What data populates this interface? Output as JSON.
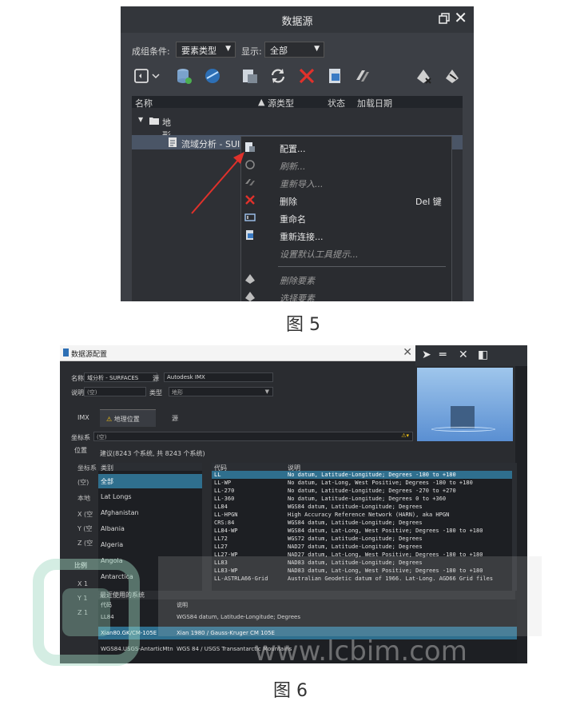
{
  "figure5": {
    "caption": "图 5",
    "title": "数据源",
    "group_label": "成组条件:",
    "group_value": "要素类型",
    "show_label": "显示:",
    "show_value": "全部",
    "columns": [
      "名称",
      "源类型",
      "状态",
      "加载日期"
    ],
    "tree_folder": "地形",
    "tree_item": "流域分析 - SUI",
    "context_menu": [
      {
        "label": "配置...",
        "key": "",
        "disabled": false,
        "icon": "config-icon"
      },
      {
        "label": "刷新...",
        "key": "",
        "disabled": true,
        "icon": "refresh-icon"
      },
      {
        "label": "重新导入...",
        "key": "",
        "disabled": true,
        "icon": "reimport-icon"
      },
      {
        "label": "删除",
        "key": "Del 键",
        "disabled": false,
        "icon": "delete-icon"
      },
      {
        "label": "重命名",
        "key": "",
        "disabled": false,
        "icon": "rename-icon"
      },
      {
        "label": "重新连接...",
        "key": "",
        "disabled": false,
        "icon": "reconnect-icon"
      },
      {
        "label": "设置默认工具提示...",
        "key": "",
        "disabled": true,
        "icon": ""
      },
      {
        "label": "删除要素",
        "key": "",
        "disabled": true,
        "icon": "delete-feature-icon"
      },
      {
        "label": "选择要素",
        "key": "",
        "disabled": true,
        "icon": "select-feature-icon"
      }
    ]
  },
  "figure6": {
    "caption": "图 6",
    "dialog_title": "数据源配置",
    "name_label": "名称",
    "name_value": "域分析 - SURFACES",
    "source_label": "源",
    "source_value": "Autodesk IMX",
    "desc_label": "说明",
    "desc_value": "(空)",
    "type_label": "类型",
    "type_value": "地形",
    "tabs": [
      "IMX",
      "地理位置",
      "源"
    ],
    "crs_label": "坐标系",
    "crs_value": "(空)",
    "position_label": "位置",
    "suggest_text": "建议(8243 个系统, 共 8243 个系统)",
    "category_header": "类别",
    "code_header": "代码",
    "desc_header": "说明",
    "left_labels": [
      "坐标系",
      "(空)",
      "本地",
      "X (空",
      "Y (空",
      "Z (空",
      "比例",
      "X 1",
      "Y 1",
      "Z 1"
    ],
    "categories": [
      "全部",
      "Lat Longs",
      "Afghanistan",
      "Albania",
      "Algeria",
      "Angola",
      "Antarctica"
    ],
    "codes": [
      {
        "code": "LL",
        "desc": "No datum, Latitude-Longitude; Degrees -180 to +180"
      },
      {
        "code": "LL-WP",
        "desc": "No datum, Lat-Long, West Positive; Degrees -180 to +180"
      },
      {
        "code": "LL-270",
        "desc": "No datum, Latitude-Longitude; Degrees -270 to +270"
      },
      {
        "code": "LL-360",
        "desc": "No datum, Latitude-Longitude; Degrees 0 to +360"
      },
      {
        "code": "LL84",
        "desc": "WGS84 datum, Latitude-Longitude; Degrees"
      },
      {
        "code": "LL-HPGN",
        "desc": "High Accuracy Reference Network (HARN), aka HPGN"
      },
      {
        "code": "CRS:84",
        "desc": "WGS84 datum, Latitude-Longitude; Degrees"
      },
      {
        "code": "LL84-WP",
        "desc": "WGS84 datum, Lat-Long, West Positive; Degrees -180 to +180"
      },
      {
        "code": "LL72",
        "desc": "WGS72 datum, Latitude-Longitude; Degrees"
      },
      {
        "code": "LL27",
        "desc": "NAD27 datum, Latitude-Longitude; Degrees"
      },
      {
        "code": "LL27-WP",
        "desc": "NAD27 datum, Lat-Long, West Positive; Degrees -180 to +180"
      },
      {
        "code": "LL83",
        "desc": "NAD83 datum, Latitude-Longitude; Degrees"
      },
      {
        "code": "LL83-WP",
        "desc": "NAD83 datum, Lat-Long, West Positive; Degrees -180 to +180"
      },
      {
        "code": "LL-ASTRLA66-Grid",
        "desc": "Australian Geodetic datum of 1966. Lat-Long. AGD66 Grid files"
      }
    ],
    "recent_title": "最近使用的系统",
    "recent": [
      {
        "code": "LL84",
        "desc": "WGS84 datum, Latitude-Longitude; Degrees"
      },
      {
        "code": "Xian80.GK/CM-105E",
        "desc": "Xian 1980 / Gauss-Kruger CM 105E"
      },
      {
        "code": "WGS84.USGS-AntarticMtn",
        "desc": "WGS 84 / USGS Transantarctic Mountains"
      }
    ]
  },
  "watermark": {
    "text": "www.lcbim.com"
  },
  "colors": {
    "panel_dark": "#3c3f45",
    "selection": "#2f6f8e",
    "delete_red": "#e0312b",
    "arrow_red": "#e0312b"
  }
}
